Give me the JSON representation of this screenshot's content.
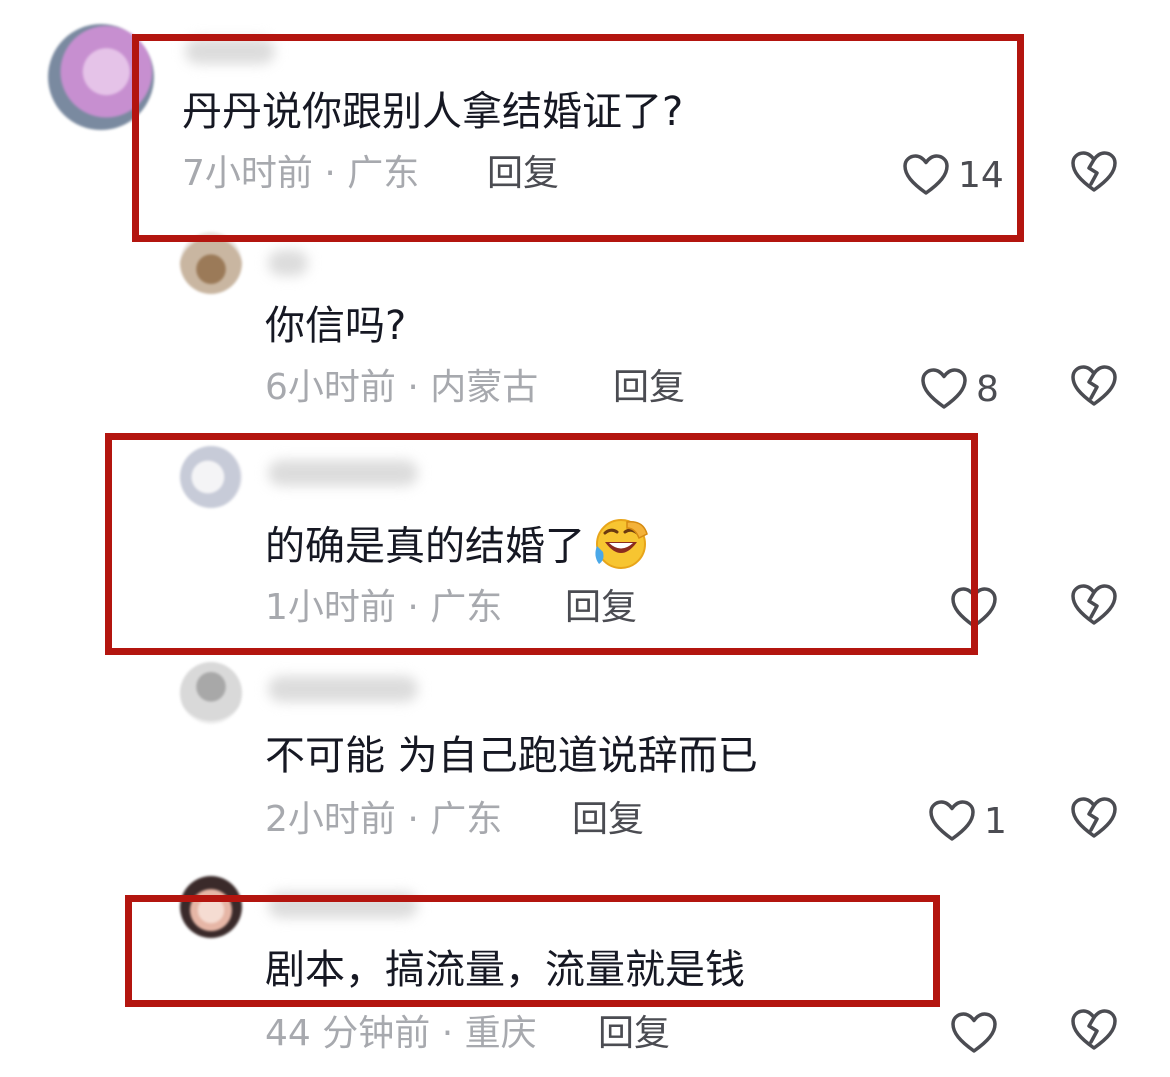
{
  "comments": [
    {
      "text": "丹丹说你跟别人拿结婚证了?",
      "time": "7小时前",
      "location": "广东",
      "reply_label": "回复",
      "likes": "14",
      "avatar_colors": [
        "#c78fd0",
        "#e5c3e8",
        "#7a5a7d"
      ]
    },
    {
      "text": "你信吗?",
      "time": "6小时前",
      "location": "内蒙古",
      "reply_label": "回复",
      "likes": "8",
      "avatar_colors": [
        "#c9b6a1",
        "#9b7a58",
        "#e9e4df"
      ]
    },
    {
      "text": "的确是真的结婚了",
      "time": "1小时前",
      "location": "广东",
      "reply_label": "回复",
      "likes": "",
      "emoji": "rofl-emoji",
      "avatar_colors": [
        "#e8e8ee",
        "#c7cbd8",
        "#f4f4f6"
      ]
    },
    {
      "text": "不可能 为自己跑道说辞而已",
      "time": "2小时前",
      "location": "广东",
      "reply_label": "回复",
      "likes": "1",
      "avatar_colors": [
        "#d9d9d9",
        "#a8a8a8",
        "#eeeeee"
      ]
    },
    {
      "text": "剧本，搞流量，流量就是钱",
      "time": "44 分钟前",
      "location": "重庆",
      "reply_label": "回复",
      "likes": "",
      "avatar_colors": [
        "#e6b6a6",
        "#3a2a2a",
        "#f5dcd2"
      ]
    }
  ],
  "meta_separator": "·",
  "colors": {
    "highlight": "#b3150f",
    "text": "#161823",
    "meta": "#a7a9ae",
    "action": "#4b4c52"
  },
  "icons": {
    "like": "heart-outline-icon",
    "dislike": "broken-heart-icon"
  }
}
